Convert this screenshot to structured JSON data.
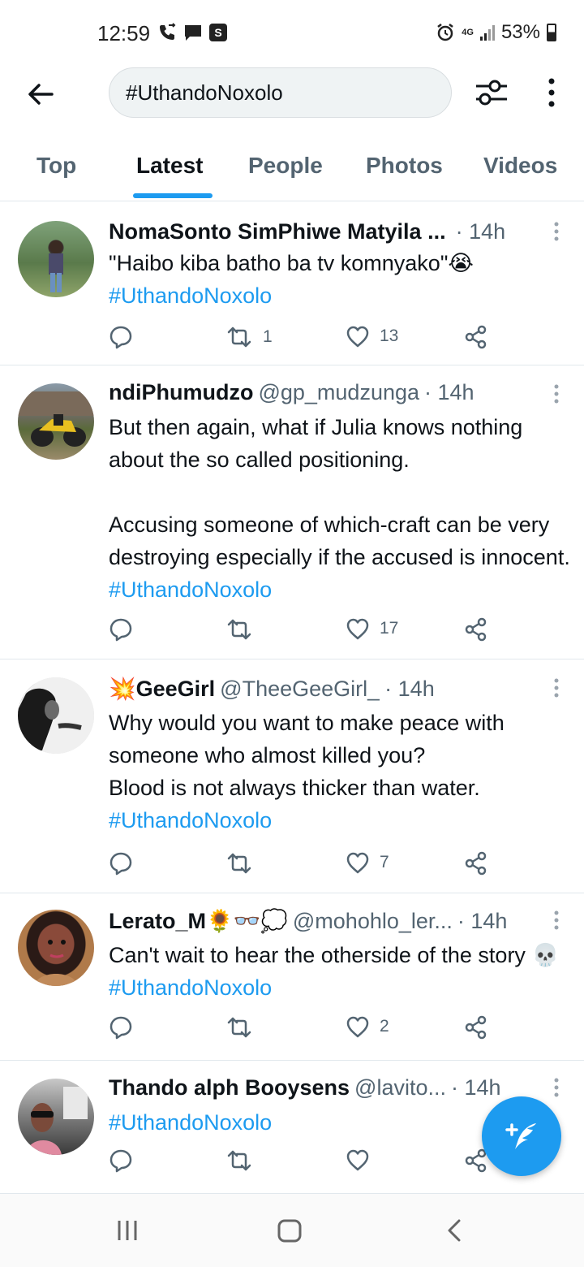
{
  "status_bar": {
    "time": "12:59",
    "network": "4G",
    "battery": "53%"
  },
  "search": {
    "query": "#UthandoNoxolo"
  },
  "tabs": [
    {
      "label": "Top"
    },
    {
      "label": "Latest"
    },
    {
      "label": "People"
    },
    {
      "label": "Photos"
    },
    {
      "label": "Videos"
    }
  ],
  "active_tab": "Latest",
  "tweets": [
    {
      "name": "NomaSonto SimPhiwe Matyila ...",
      "handle": "",
      "time": "· 14h",
      "text": "\"Haibo kiba batho ba tv komnyako\"😭",
      "hashtag": "#UthandoNoxolo",
      "retweets": "1",
      "likes": "13"
    },
    {
      "name": "ndiPhumudzo",
      "handle": "@gp_mudzunga",
      "time": "· 14h",
      "text": "But then again, what if Julia knows nothing about the so called positioning.\n\nAccusing someone of which-craft can be very destroying especially if the accused is innocent. ",
      "hashtag": "#UthandoNoxolo",
      "retweets": "",
      "likes": "17"
    },
    {
      "name": "💥GeeGirl",
      "handle": "@TheeGeeGirl_",
      "time": "· 14h",
      "text": "Why would you want to make peace with someone who almost killed you?\nBlood is not always thicker than water.",
      "hashtag": "#UthandoNoxolo",
      "retweets": "",
      "likes": "7"
    },
    {
      "name": "Lerato_M🌻👓💭",
      "handle": "@mohohlo_ler...",
      "time": "· 14h",
      "text": "Can't wait to hear the otherside of the story 💀 ",
      "hashtag": "#UthandoNoxolo",
      "retweets": "",
      "likes": "2"
    },
    {
      "name": "Thando alph Booysens",
      "handle": "@lavito...",
      "time": "· 14h",
      "text": "",
      "hashtag": "#UthandoNoxolo",
      "retweets": "",
      "likes": ""
    }
  ],
  "colors": {
    "accent": "#1d9bf0",
    "text": "#0f1419",
    "muted": "#536471"
  },
  "icons": [
    "back-arrow-icon",
    "filter-icon",
    "more-vertical-icon",
    "reply-icon",
    "retweet-icon",
    "like-icon",
    "share-icon",
    "compose-icon",
    "recents-icon",
    "home-icon",
    "back-nav-icon"
  ]
}
